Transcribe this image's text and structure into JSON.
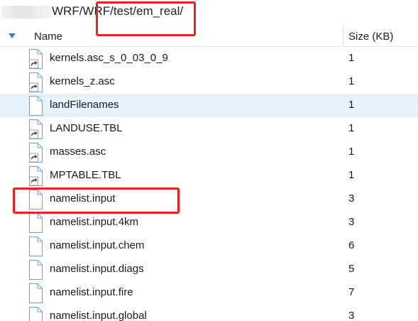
{
  "path": {
    "text": "WRF/WRF/test/em_real/"
  },
  "header": {
    "name_label": "Name",
    "size_label": "Size (KB)",
    "sort_icon": "sort-descending-icon"
  },
  "files": [
    {
      "name": "kernels.asc_s_0_03_0_9",
      "size": "1",
      "icon": "shortcut-file-icon",
      "shortcut": true,
      "selected": false
    },
    {
      "name": "kernels_z.asc",
      "size": "1",
      "icon": "shortcut-file-icon",
      "shortcut": true,
      "selected": false
    },
    {
      "name": "landFilenames",
      "size": "1",
      "icon": "file-icon",
      "shortcut": false,
      "selected": true
    },
    {
      "name": "LANDUSE.TBL",
      "size": "1",
      "icon": "shortcut-file-icon",
      "shortcut": true,
      "selected": false
    },
    {
      "name": "masses.asc",
      "size": "1",
      "icon": "shortcut-file-icon",
      "shortcut": true,
      "selected": false
    },
    {
      "name": "MPTABLE.TBL",
      "size": "1",
      "icon": "shortcut-file-icon",
      "shortcut": true,
      "selected": false
    },
    {
      "name": "namelist.input",
      "size": "3",
      "icon": "file-icon",
      "shortcut": false,
      "selected": false
    },
    {
      "name": "namelist.input.4km",
      "size": "3",
      "icon": "file-icon",
      "shortcut": false,
      "selected": false
    },
    {
      "name": "namelist.input.chem",
      "size": "6",
      "icon": "file-icon",
      "shortcut": false,
      "selected": false
    },
    {
      "name": "namelist.input.diags",
      "size": "5",
      "icon": "file-icon",
      "shortcut": false,
      "selected": false
    },
    {
      "name": "namelist.input.fire",
      "size": "7",
      "icon": "file-icon",
      "shortcut": false,
      "selected": false
    },
    {
      "name": "namelist.input.global",
      "size": "3",
      "icon": "file-icon",
      "shortcut": false,
      "selected": false
    }
  ],
  "colors": {
    "selection": "#e5f1fb",
    "callout": "#e8261f",
    "shortcut_arrow": "#4a4a4a",
    "file_outline": "#6f9fd0"
  }
}
